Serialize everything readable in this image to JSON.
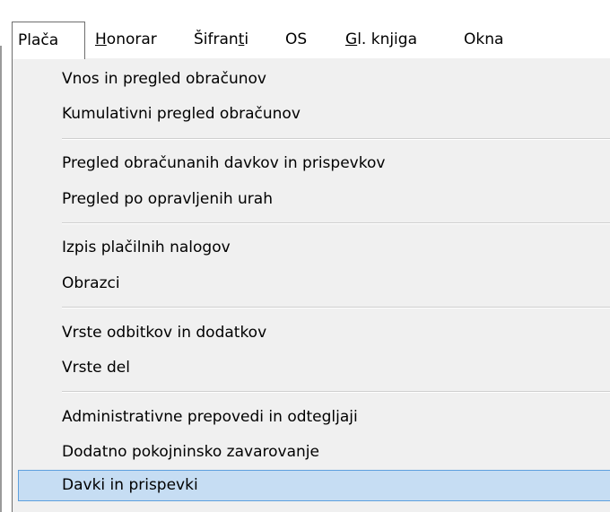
{
  "menubar": {
    "items": [
      {
        "label": "Plača",
        "open": true
      },
      {
        "label_first": "H",
        "label_rest": "onorar"
      },
      {
        "label_pre": "Šifran",
        "label_u": "t",
        "label_post": "i"
      },
      {
        "label": "OS"
      },
      {
        "label_first": "G",
        "label_rest": "l. knjiga"
      },
      {
        "label": "Okna"
      }
    ]
  },
  "dropdown": {
    "items": [
      "Vnos in pregled obračunov",
      "Kumulativni pregled obračunov",
      "Pregled obračunanih davkov in prispevkov",
      "Pregled po opravljenih urah",
      "Izpis plačilnih nalogov",
      "Obrazci",
      "Vrste odbitkov in dodatkov",
      "Vrste del",
      "Administrativne prepovedi in odtegljaji",
      "Dodatno pokojninsko zavarovanje",
      "Davki in prispevki"
    ],
    "selected_item": "Davki in prispevki"
  },
  "colors": {
    "menu_background": "#f0f0f0",
    "selected_background": "#c6ddf3",
    "selected_border": "#5ea0de"
  }
}
